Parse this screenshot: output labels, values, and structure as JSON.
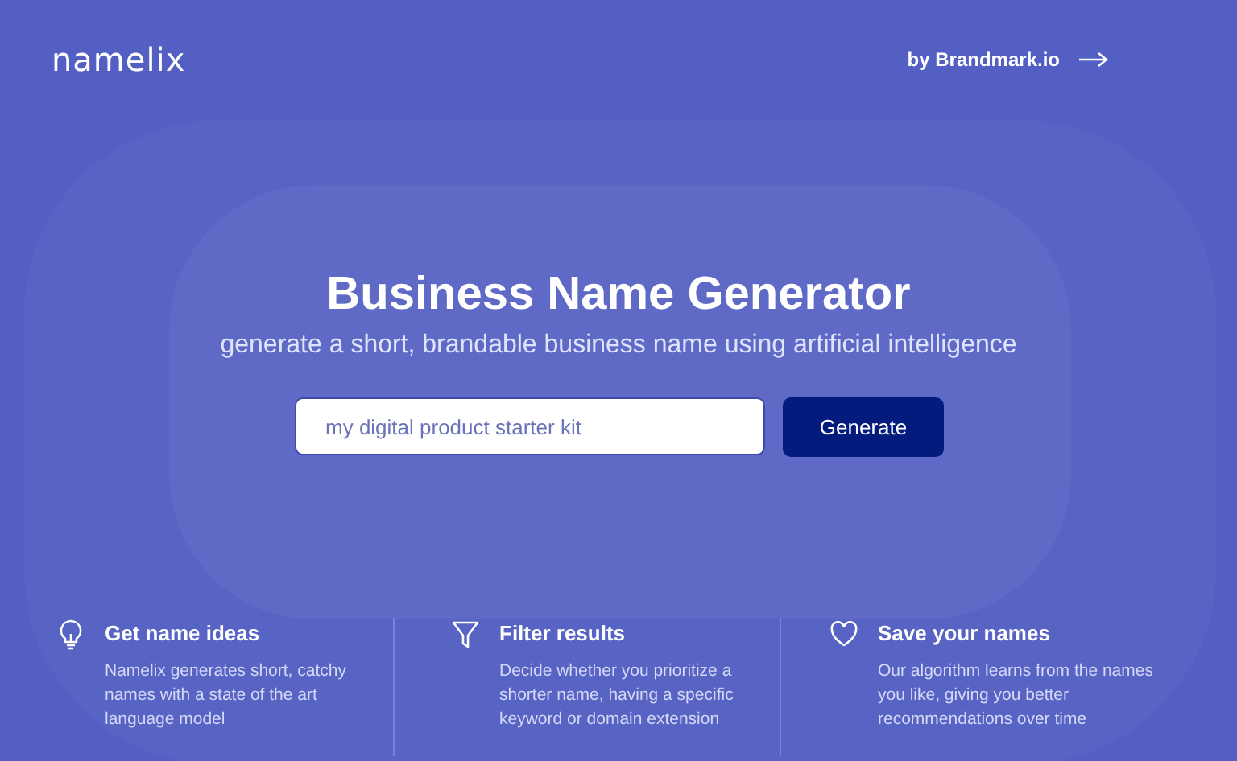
{
  "header": {
    "logo": "namelix",
    "link": "by Brandmark.io"
  },
  "hero": {
    "title": "Business Name Generator",
    "subtitle": "generate a short, brandable business name using artificial intelligence"
  },
  "search": {
    "placeholder": "my digital product starter kit",
    "button": "Generate"
  },
  "features": [
    {
      "kind": "bulb",
      "title": "Get name ideas",
      "text": "Namelix generates short, catchy names with a state of the art language model"
    },
    {
      "kind": "filter",
      "title": "Filter results",
      "text": "Decide whether you prioritize a shorter name, having a specific keyword or domain extension"
    },
    {
      "kind": "heart",
      "title": "Save your names",
      "text": "Our algorithm learns from the names you like, giving you better recommendations over time"
    }
  ]
}
